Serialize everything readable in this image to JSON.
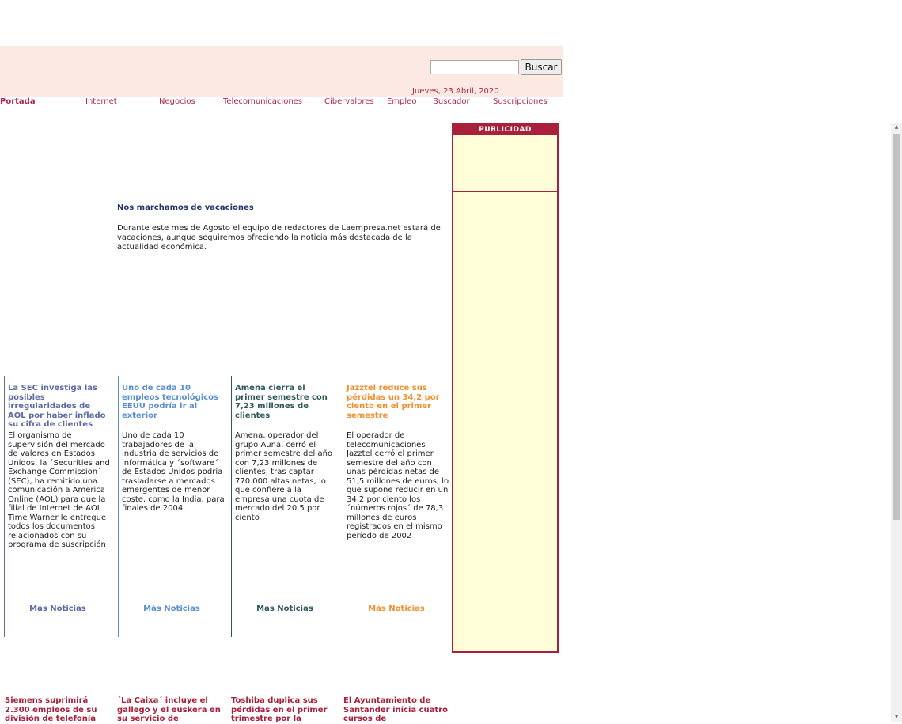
{
  "search": {
    "value": "",
    "button_label": "Buscar"
  },
  "date": "Jueves, 23 Abril, 2020",
  "nav": [
    {
      "label": "Portada"
    },
    {
      "label": "Internet"
    },
    {
      "label": "Negocios"
    },
    {
      "label": "Telecomunicaciones"
    },
    {
      "label": "Cibervalores"
    },
    {
      "label": "Empleo"
    },
    {
      "label": "Buscador"
    },
    {
      "label": "Suscripciones"
    }
  ],
  "ad": {
    "label": "PUBLICIDAD"
  },
  "feature": {
    "title": "Nos marchamos de vacaciones",
    "text": "Durante este mes de Agosto el equipo de redactores de Laempresa.net estará de vacaciones, aunque seguiremos ofreciendo la noticia más destacada de la actualidad económica."
  },
  "columns": [
    {
      "title": "La SEC investiga las posibles irregularidades de AOL por haber inflado su cifra de clientes",
      "text": "El organismo de supervisión del mercado de valores en Estados Unidos, la ´Securities and Exchange Commission´ (SEC), ha remitido una comunicación a America Online (AOL) para que la filial de Internet de AOL Time Warner le entregue todos los documentos relacionados con su programa de suscripción",
      "more": "Más Noticias",
      "color": "#5d6aa4"
    },
    {
      "title": "Uno de cada 10 empleos tecnológicos EEUU podría ir al exterior",
      "text": "Uno de cada 10 trabajadores de la industria de servicios de informática y ´software´ de Estados Unidos podría trasladarse a mercados emergentes de menor coste, como la India, para finales de 2004.",
      "more": "Más Noticias",
      "color": "#5b8fcf"
    },
    {
      "title": "Amena cierra el primer semestre con 7,23 millones de clientes",
      "text": "Amena, operador del grupo Auna, cerró el primer semestre del año con 7,23 millones de clientes, tras captar 770.000 altas netas, lo que confiere a la empresa una cuota de mercado del 20,5 por ciento",
      "more": "Más Noticias",
      "color": "#2f5a5c"
    },
    {
      "title": "Jazztel reduce sus pérdidas un 34,2 por ciento en el primer semestre",
      "text": "El operador de telecomunicaciones Jazztel cerró el primer semestre del año con unas pérdidas netas de 51,5 millones de euros, lo que supone reducir en un 34,2 por ciento los ´números rojos´ de 78,3 millones de euros registrados en el mismo período de 2002",
      "more": "Más Noticias",
      "color": "#f0902e"
    }
  ],
  "bottom": [
    {
      "title": "Siemens suprimirá 2.300 empleos de su división de telefonía"
    },
    {
      "title": "´La Caixa´ incluye el gallego y el euskera en su servicio de"
    },
    {
      "title": "Toshiba duplica sus pérdidas en el primer trimestre por la"
    },
    {
      "title": "El Ayuntamiento de Santander inicia cuatro cursos de"
    }
  ]
}
